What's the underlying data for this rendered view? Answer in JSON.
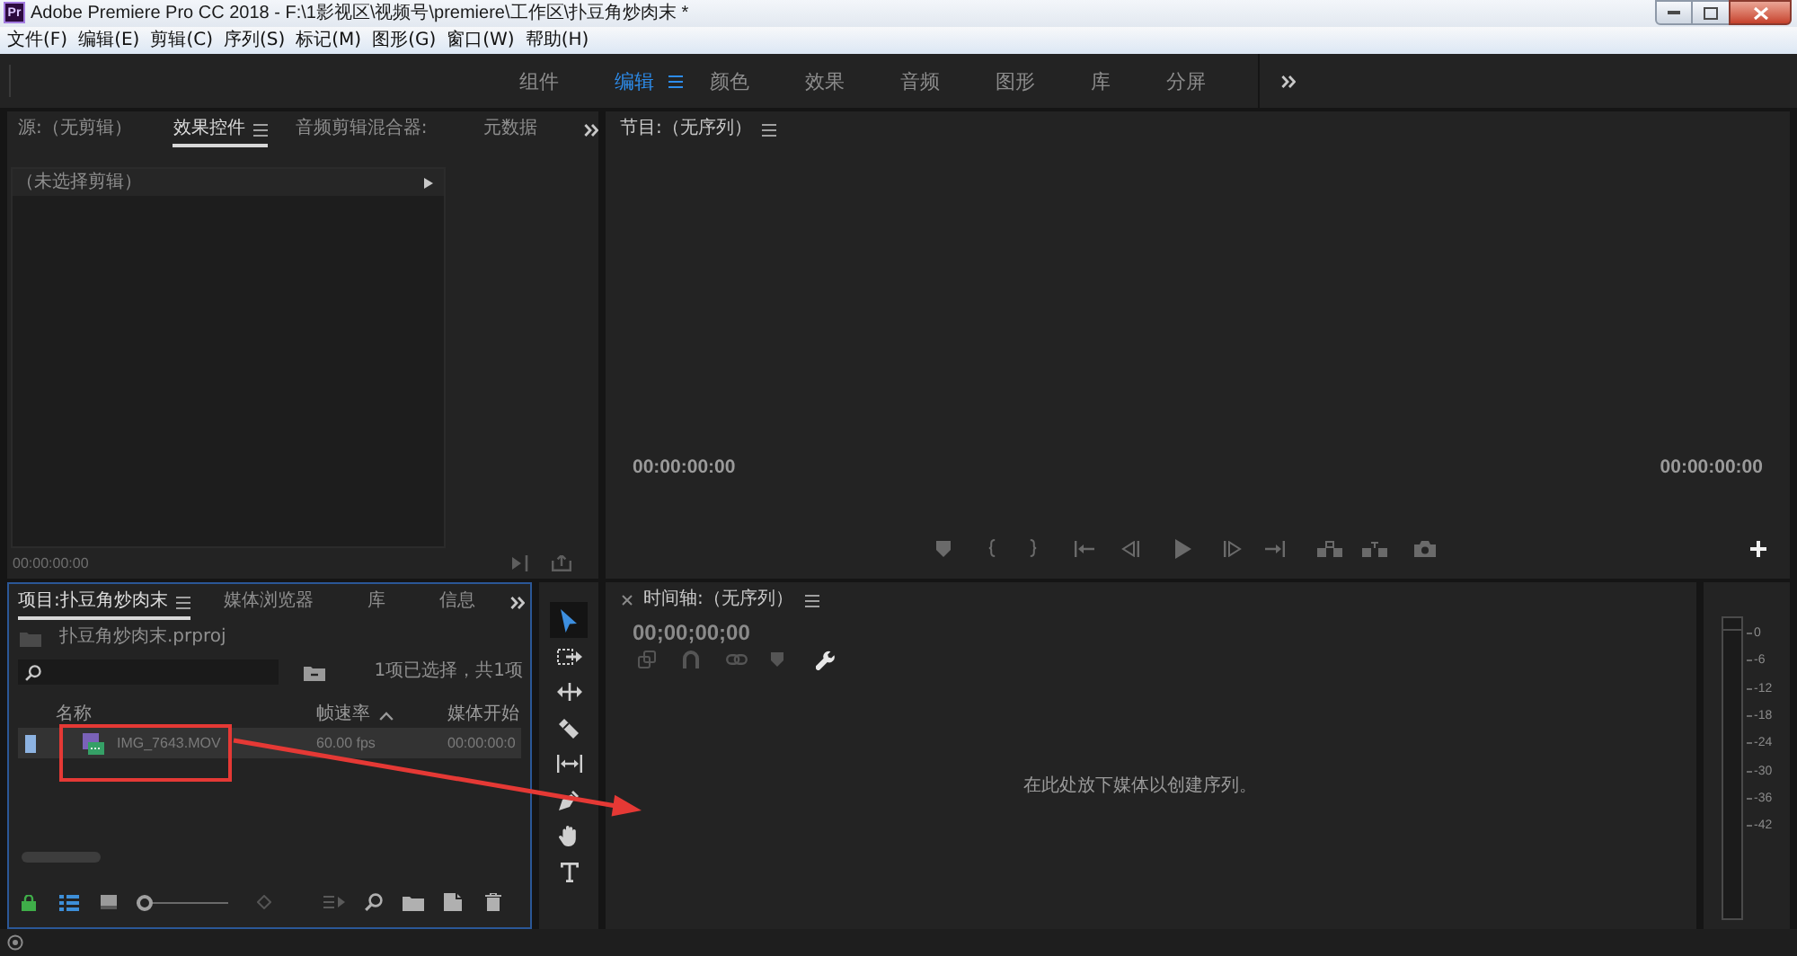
{
  "window": {
    "logo": "Pr",
    "title": "Adobe Premiere Pro CC 2018 - F:\\1影视区\\视频号\\premiere\\工作区\\扑豆角炒肉末 *"
  },
  "menu": [
    "文件(F)",
    "编辑(E)",
    "剪辑(C)",
    "序列(S)",
    "标记(M)",
    "图形(G)",
    "窗口(W)",
    "帮助(H)"
  ],
  "workspaces": [
    {
      "label": "组件",
      "selected": false
    },
    {
      "label": "编辑",
      "selected": true
    },
    {
      "label": "颜色",
      "selected": false
    },
    {
      "label": "效果",
      "selected": false
    },
    {
      "label": "音频",
      "selected": false
    },
    {
      "label": "图形",
      "selected": false
    },
    {
      "label": "库",
      "selected": false
    },
    {
      "label": "分屏",
      "selected": false
    }
  ],
  "effects_panel": {
    "tabs": [
      {
        "label": "源:（无剪辑）",
        "selected": false
      },
      {
        "label": "效果控件",
        "selected": true
      },
      {
        "label": "音频剪辑混合器:",
        "selected": false
      },
      {
        "label": "元数据",
        "selected": false
      }
    ],
    "clip_header": "（未选择剪辑）",
    "timecode": "00:00:00:00"
  },
  "program_monitor": {
    "title": "节目:（无序列）",
    "timecode_left": "00:00:00:00",
    "timecode_right": "00:00:00:00"
  },
  "project_panel": {
    "tabs": [
      {
        "label": "项目:扑豆角炒肉末",
        "selected": true
      },
      {
        "label": "媒体浏览器",
        "selected": false
      },
      {
        "label": "库",
        "selected": false
      },
      {
        "label": "信息",
        "selected": false
      }
    ],
    "project_file": "扑豆角炒肉末.prproj",
    "selection_count": "1项已选择，共1项",
    "columns": [
      {
        "label": "名称",
        "sorted": false
      },
      {
        "label": "帧速率",
        "sorted": true
      },
      {
        "label": "媒体开始",
        "sorted": false
      }
    ],
    "rows": [
      {
        "name": "IMG_7643.MOV",
        "frame_rate": "60.00 fps",
        "media_start": "00:00:00:0",
        "color": "#8db3e2",
        "selected": true
      }
    ],
    "zoom": {
      "level": 0
    }
  },
  "tools": [
    {
      "kind": "selection",
      "selected": true
    },
    {
      "kind": "track_select",
      "selected": false
    },
    {
      "kind": "ripple",
      "selected": false
    },
    {
      "kind": "razor",
      "selected": false
    },
    {
      "kind": "slip",
      "selected": false
    },
    {
      "kind": "pen",
      "selected": false
    },
    {
      "kind": "hand",
      "selected": false
    },
    {
      "kind": "type",
      "selected": false
    }
  ],
  "timeline": {
    "title": "时间轴:（无序列）",
    "timecode": "00;00;00;00",
    "drop_hint": "在此处放下媒体以创建序列。"
  },
  "audio_meter": {
    "scale": [
      "0",
      "-6",
      "-12",
      "-18",
      "-24",
      "-30",
      "-36",
      "-42"
    ]
  }
}
